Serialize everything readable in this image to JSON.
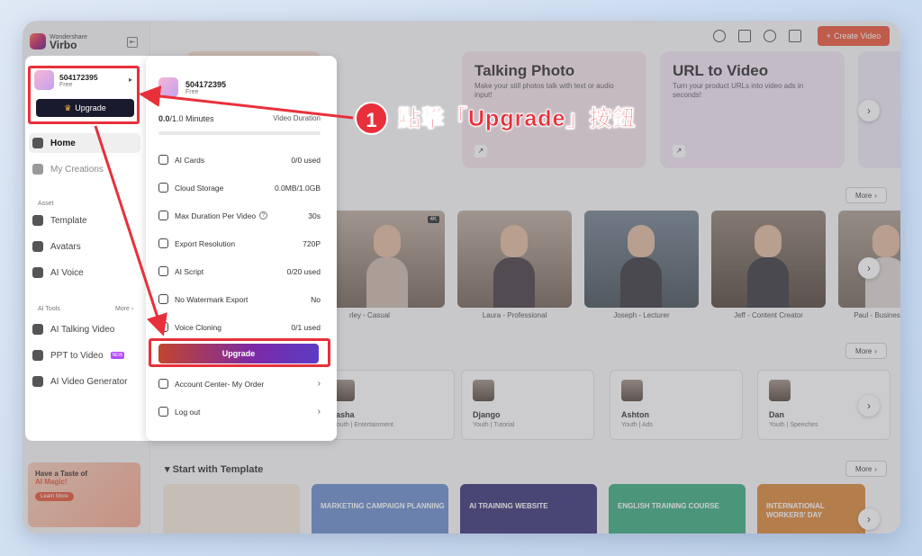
{
  "app": {
    "brand_top": "Wondershare",
    "brand_name": "Virbo",
    "create_video": "Create Video"
  },
  "sidebar": {
    "home": "Home",
    "my_creations": "My Creations",
    "asset_section": "Asset",
    "template": "Template",
    "avatars": "Avatars",
    "ai_voice": "AI Voice",
    "tools_section": "AI Tools",
    "more": "More",
    "talking_video": "AI Talking Video",
    "ppt_to_video": "PPT to Video",
    "ppt_badge": "NEW",
    "video_generator": "AI Video Generator",
    "promo_line1": "Have a Taste of",
    "promo_line2": "AI Magic!",
    "promo_btn": "Learn More"
  },
  "feature_cards": [
    {
      "title": "Talking Photo",
      "desc": "Make your still photos talk with text or audio input!"
    },
    {
      "title": "URL to Video",
      "desc": "Turn your product URLs into video ads in seconds!"
    }
  ],
  "more_label": "More",
  "avatars": [
    {
      "name": "rley - Casual"
    },
    {
      "name": "Laura - Professional"
    },
    {
      "name": "Joseph - Lecturer"
    },
    {
      "name": "Jeff - Content Creator"
    },
    {
      "name": "Paul - Business"
    }
  ],
  "avatar_badge": "4K",
  "voices": [
    {
      "name": "tasha",
      "desc": "Youth | Entertainment"
    },
    {
      "name": "Django",
      "desc": "Youth | Tutorial"
    },
    {
      "name": "Ashton",
      "desc": "Youth | Ads"
    },
    {
      "name": "Dan",
      "desc": "Youth | Speeches"
    }
  ],
  "templates": {
    "title": "Start with Template",
    "items": [
      "",
      "MARKETING CAMPAIGN PLANNING",
      "AI TRAINING WEBSITE",
      "ENGLISH TRAINING COURSE",
      "INTERNATIONAL WORKERS' DAY"
    ]
  },
  "account": {
    "user_id": "504172395",
    "plan": "Free",
    "minutes_used": "0.0",
    "minutes_total": "/1.0 Minutes",
    "minutes_label": "Video Duration",
    "features": [
      {
        "label": "AI Cards",
        "value": "0/0 used"
      },
      {
        "label": "Cloud Storage",
        "value": "0.0MB/1.0GB"
      },
      {
        "label": "Max Duration Per Video",
        "value": "30s"
      },
      {
        "label": "Export Resolution",
        "value": "720P"
      },
      {
        "label": "AI Script",
        "value": "0/20 used"
      },
      {
        "label": "No Watermark Export",
        "value": "No"
      },
      {
        "label": "Voice Cloning",
        "value": "0/1 used"
      }
    ],
    "upgrade": "Upgrade",
    "account_center": "Account Center- My Order",
    "logout": "Log out"
  },
  "annotation": {
    "step": "1",
    "text": "點擊「Upgrade」按鈕"
  },
  "colors": {
    "accent": "#ea4b2c",
    "annotation": "#e8303b"
  }
}
